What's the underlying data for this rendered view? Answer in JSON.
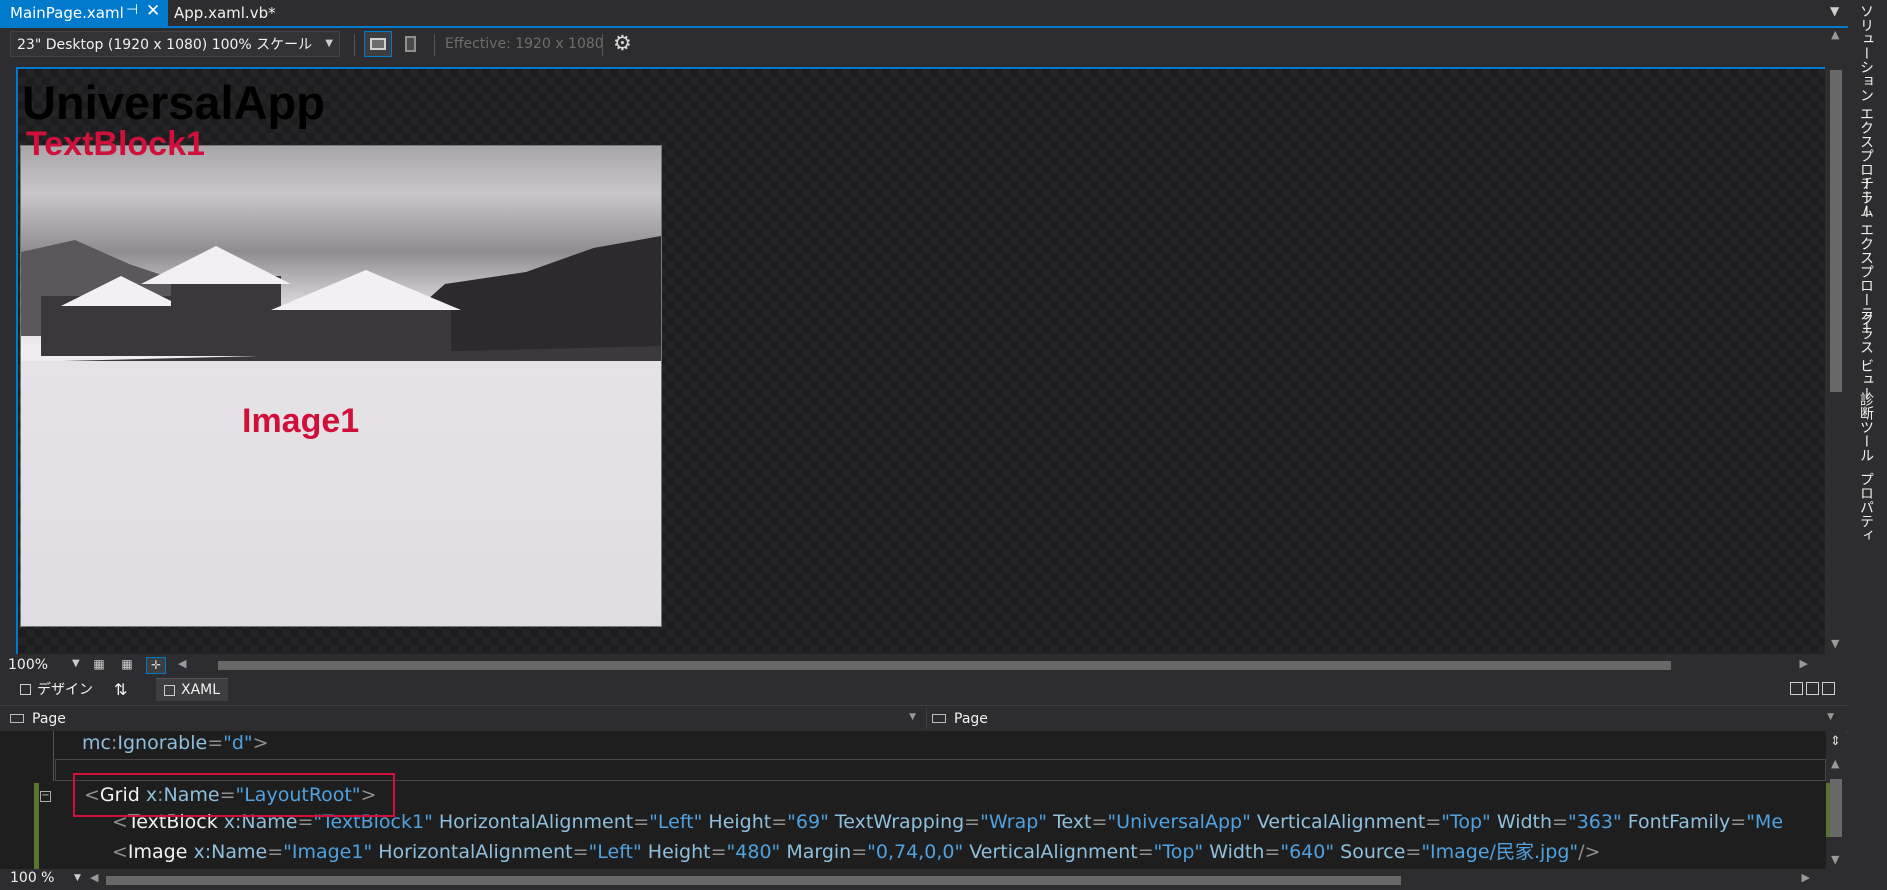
{
  "tabs": [
    {
      "label": "MainPage.xaml",
      "active": true
    },
    {
      "label": "App.xaml.vb*",
      "active": false
    }
  ],
  "design_toolbar": {
    "device": "23\" Desktop (1920 x 1080) 100% スケール",
    "effective": "Effective: 1920 x 1080"
  },
  "design": {
    "app_title": "UniversalApp",
    "textblock_label": "TextBlock1",
    "image_label": "Image1"
  },
  "zoom": {
    "design": "100%",
    "editor": "100 %"
  },
  "split": {
    "design_tab": "デザイン",
    "swap": "⇅",
    "xaml_tab": "XAML"
  },
  "nav": {
    "left": "Page",
    "right": "Page"
  },
  "code": {
    "line1": {
      "prefix": "mc",
      "attr": "Ignorable",
      "value": "\"d\"",
      "close": ">"
    },
    "line3": {
      "open": "<",
      "tag": "Grid",
      "attr_prefix": "x",
      "attr": "Name",
      "value": "\"LayoutRoot\"",
      "close": ">"
    },
    "line4": [
      {
        "k": "tag",
        "t": "TextBlock"
      },
      {
        "k": "attr",
        "t": " x:Name"
      },
      {
        "k": "val",
        "t": "\"TextBlock1\""
      },
      {
        "k": "attr",
        "t": " HorizontalAlignment"
      },
      {
        "k": "val",
        "t": "\"Left\""
      },
      {
        "k": "attr",
        "t": " Height"
      },
      {
        "k": "val",
        "t": "\"69\""
      },
      {
        "k": "attr",
        "t": " TextWrapping"
      },
      {
        "k": "val",
        "t": "\"Wrap\""
      },
      {
        "k": "attr",
        "t": " Text"
      },
      {
        "k": "val",
        "t": "\"UniversalApp\""
      },
      {
        "k": "attr",
        "t": " VerticalAlignment"
      },
      {
        "k": "val",
        "t": "\"Top\""
      },
      {
        "k": "attr",
        "t": " Width"
      },
      {
        "k": "val",
        "t": "\"363\""
      },
      {
        "k": "attr",
        "t": " FontFamily"
      },
      {
        "k": "val",
        "t": "\"Me"
      }
    ],
    "line5": [
      {
        "k": "tag",
        "t": "Image"
      },
      {
        "k": "attr",
        "t": " x:Name"
      },
      {
        "k": "val",
        "t": "\"Image1\""
      },
      {
        "k": "attr",
        "t": " HorizontalAlignment"
      },
      {
        "k": "val",
        "t": "\"Left\""
      },
      {
        "k": "attr",
        "t": " Height"
      },
      {
        "k": "val",
        "t": "\"480\""
      },
      {
        "k": "attr",
        "t": " Margin"
      },
      {
        "k": "val",
        "t": "\"0,74,0,0\""
      },
      {
        "k": "attr",
        "t": " VerticalAlignment"
      },
      {
        "k": "val",
        "t": "\"Top\""
      },
      {
        "k": "attr",
        "t": " Width"
      },
      {
        "k": "val",
        "t": "\"640\""
      },
      {
        "k": "attr",
        "t": " Source"
      },
      {
        "k": "val",
        "t": "\"Image/民家.jpg\""
      },
      {
        "k": "punc",
        "t": "/>"
      }
    ]
  },
  "right_dock": [
    "ソリューション エクスプローラー",
    "チーム エクスプローラー",
    "クラス ビュー",
    "診断ツール",
    "プロパティ"
  ],
  "colors": {
    "accent": "#007acc",
    "label_red": "#d0103a",
    "xaml_value": "#4fa1e0",
    "xaml_attr": "#8fbfdc"
  }
}
